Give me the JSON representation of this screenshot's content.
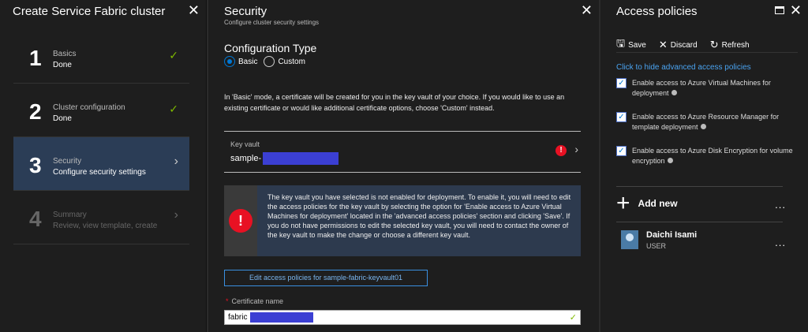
{
  "wizard": {
    "title": "Create Service Fabric cluster",
    "steps": [
      {
        "number": "1",
        "label": "Basics",
        "sub": "Done",
        "state": "done"
      },
      {
        "number": "2",
        "label": "Cluster configuration",
        "sub": "Done",
        "state": "done"
      },
      {
        "number": "3",
        "label": "Security",
        "sub": "Configure security settings",
        "state": "active"
      },
      {
        "number": "4",
        "label": "Summary",
        "sub": "Review, view template, create",
        "state": "disabled"
      }
    ]
  },
  "security": {
    "title": "Security",
    "subtitle": "Configure cluster security settings",
    "config_type_label": "Configuration Type",
    "radio_basic": "Basic",
    "radio_custom": "Custom",
    "selected_config": "Basic",
    "mode_description": "In 'Basic' mode, a certificate will be created for you in the key vault of your choice. If you would like to use an existing certificate or would like additional certificate options, choose 'Custom' instead.",
    "key_vault_label": "Key vault",
    "key_vault_value": "sample-",
    "alert_text": "The key vault you have selected is not enabled for deployment. To enable it, you will need to edit the access policies for the key vault by selecting the option for 'Enable access to Azure Virtual Machines for deployment' located in the 'advanced access policies' section and clicking 'Save'. If you do not have permissions to edit the selected key vault, you will need to contact the owner of the key vault to make the change or choose a different key vault.",
    "edit_button": "Edit access policies for sample-fabric-keyvault01",
    "cert_label": "Certificate name",
    "cert_required_mark": "*",
    "cert_value": "fabric"
  },
  "access": {
    "title": "Access policies",
    "toolbar": {
      "save": "Save",
      "discard": "Discard",
      "refresh": "Refresh"
    },
    "hide_link": "Click to hide advanced access policies",
    "policies": [
      {
        "text": "Enable access to Azure Virtual Machines for deployment",
        "checked": true
      },
      {
        "text": "Enable access to Azure Resource Manager for template deployment",
        "checked": true
      },
      {
        "text": "Enable access to Azure Disk Encryption for volume encryption",
        "checked": true
      }
    ],
    "add_new": "Add new",
    "user": {
      "name": "Daichi Isami",
      "role": "USER"
    },
    "more": "..."
  },
  "icons": {
    "check": "✓",
    "chevron": "›",
    "close": "✕",
    "error": "!",
    "plus": "+"
  },
  "colors": {
    "accent": "#0078d4",
    "success": "#7fba00",
    "error": "#e81123",
    "active_step_bg": "#2b3d56",
    "link": "#4aa3f0"
  }
}
